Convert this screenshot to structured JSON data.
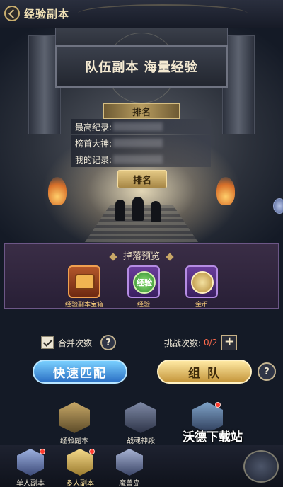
{
  "header": {
    "title": "经验副本"
  },
  "banner": {
    "title": "队伍副本  海量经验"
  },
  "ranking": {
    "tag": "排名",
    "rows": [
      {
        "label": "最高纪录:"
      },
      {
        "label": "榜首大神:"
      },
      {
        "label": "我的记录:"
      }
    ],
    "button": "排名"
  },
  "drops": {
    "title": "掉落预览",
    "items": [
      {
        "label": "经验副本宝箱",
        "icon": "treasure-chest-icon"
      },
      {
        "label": "经验",
        "badge": "经验",
        "icon": "exp-orb-icon"
      },
      {
        "label": "金币",
        "icon": "gold-coin-icon"
      }
    ]
  },
  "controls": {
    "merge_label": "合并次数",
    "merge_checked": true,
    "help": "?",
    "challenge_label": "挑战次数:",
    "challenge_count": "0/2",
    "plus": "+"
  },
  "buttons": {
    "quick_match": "快速匹配",
    "team": "组 队",
    "help": "?"
  },
  "modes": [
    {
      "label": "经验副本"
    },
    {
      "label": "战魂神殿"
    },
    {
      "label": ""
    }
  ],
  "bottom_tabs": [
    {
      "label": "单人副本"
    },
    {
      "label": "多人副本"
    },
    {
      "label": "魔兽岛"
    }
  ],
  "watermark": "沃德下载站",
  "colors": {
    "accent_gold": "#c9ae6e",
    "quick_blue": "#2a6fc4",
    "team_gold": "#c4953a",
    "count_red": "#ff6a4d"
  }
}
